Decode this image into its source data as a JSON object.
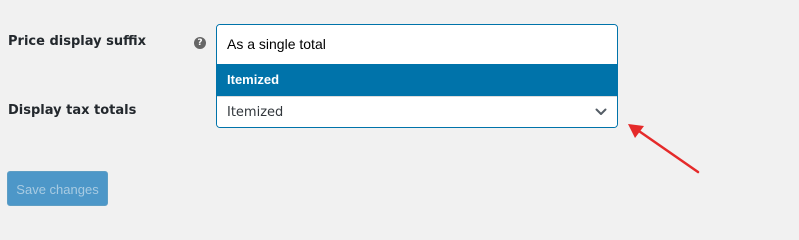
{
  "settings": {
    "price_display_suffix_label": "Price display suffix",
    "help_icon_glyph": "?",
    "display_tax_totals_label": "Display tax totals"
  },
  "tax_totals_dropdown": {
    "options": [
      "As a single total",
      "Itemized"
    ],
    "highlighted_option": "Itemized",
    "selected_value": "Itemized",
    "accent_color": "#0073aa"
  },
  "actions": {
    "save_label": "Save changes",
    "save_state": "disabled"
  },
  "annotation": {
    "arrow_color": "#e52a2a"
  },
  "icons": {
    "help": "question-circle-icon",
    "dropdown": "chevron-down-icon",
    "annotation": "red-arrow-icon"
  }
}
